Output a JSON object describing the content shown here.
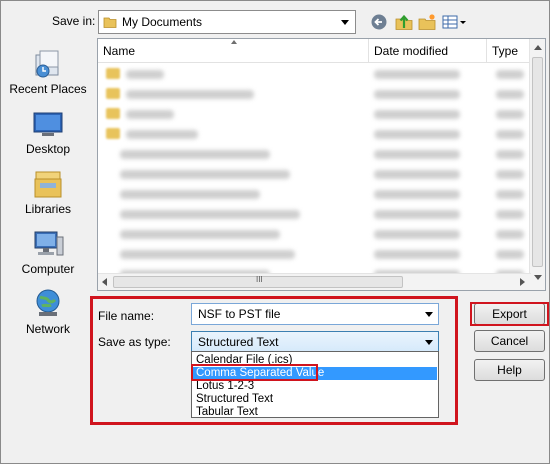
{
  "header": {
    "save_in_label": "Save in:",
    "save_in_value": "My Documents"
  },
  "toolbar": {
    "icons": [
      "back-icon",
      "up-folder-icon",
      "new-folder-icon",
      "view-menu-icon"
    ]
  },
  "places": [
    {
      "label": "Recent Places",
      "icon": "recent-places-icon"
    },
    {
      "label": "Desktop",
      "icon": "desktop-icon"
    },
    {
      "label": "Libraries",
      "icon": "libraries-icon"
    },
    {
      "label": "Computer",
      "icon": "computer-icon"
    },
    {
      "label": "Network",
      "icon": "network-icon"
    }
  ],
  "file_list": {
    "columns": [
      "Name",
      "Date modified",
      "Type"
    ],
    "scroll_grip": "III"
  },
  "form": {
    "file_name_label": "File name:",
    "file_name_value": "NSF to PST file",
    "save_as_type_label": "Save as type:",
    "save_as_type_value": "Structured Text",
    "type_options": [
      "Calendar File (.ics)",
      "Comma Separated Value",
      "Lotus 1-2-3",
      "Structured Text",
      "Tabular Text"
    ],
    "selected_option": "Comma Separated Value"
  },
  "buttons": {
    "export": "Export",
    "cancel": "Cancel",
    "help": "Help"
  },
  "colors": {
    "highlight_red": "#d0141e",
    "selection_blue": "#3399ff"
  }
}
